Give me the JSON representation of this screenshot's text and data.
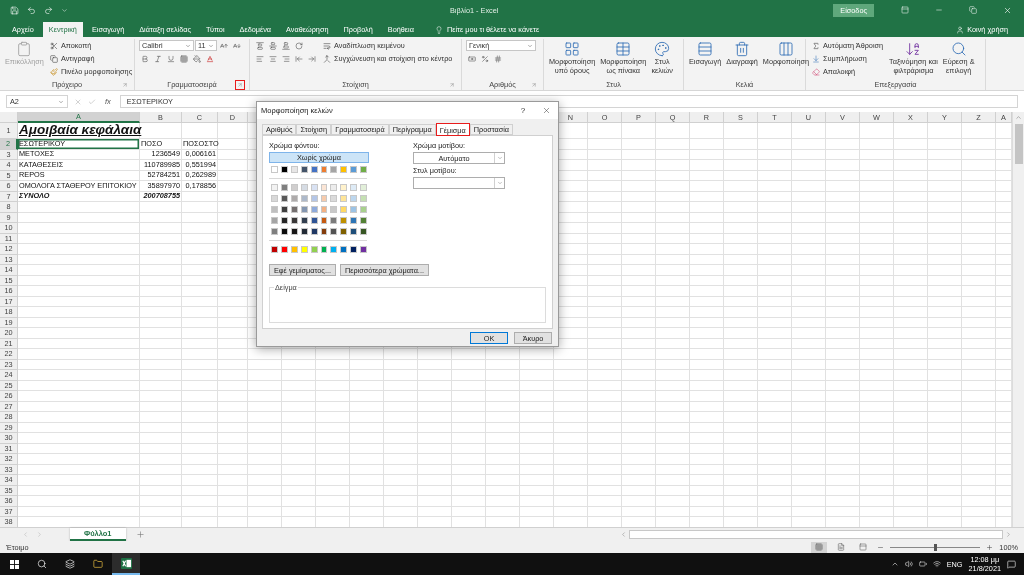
{
  "title_bar": {
    "title": "Βιβλίο1 - Excel",
    "sign_in": "Είσοδος"
  },
  "menu_tabs": [
    {
      "label": "Αρχείο",
      "selected": false
    },
    {
      "label": "Κεντρική",
      "selected": true
    },
    {
      "label": "Εισαγωγή",
      "selected": false
    },
    {
      "label": "Διάταξη σελίδας",
      "selected": false
    },
    {
      "label": "Τύποι",
      "selected": false
    },
    {
      "label": "Δεδομένα",
      "selected": false
    },
    {
      "label": "Αναθεώρηση",
      "selected": false
    },
    {
      "label": "Προβολή",
      "selected": false
    },
    {
      "label": "Βοήθεια",
      "selected": false
    }
  ],
  "tell_me": "Πείτε μου τι θέλετε να κάνετε",
  "share": "Κοινή χρήση",
  "ribbon": {
    "clipboard": {
      "label": "Πρόχειρο",
      "launcher_highlighted": false,
      "paste": {
        "label": "Επικόλληση",
        "disabled": true
      },
      "cut": "Αποκοπή",
      "copy": "Αντιγραφή",
      "format_painter": "Πινέλο μορφοποίησης"
    },
    "font": {
      "label": "Γραμματοσειρά",
      "launcher_highlighted": true,
      "font_name": "Calibri",
      "font_size": "11"
    },
    "alignment": {
      "label": "Στοίχιση",
      "launcher_highlighted": false,
      "wrap_text": "Αναδίπλωση κειμένου",
      "merge_center": "Συγχώνευση και στοίχιση στο κέντρο"
    },
    "number": {
      "label": "Αριθμός",
      "launcher_highlighted": false,
      "format": "Γενική"
    },
    "styles": {
      "label": "Στυλ",
      "buttons": [
        [
          "Μορφοποίηση",
          "υπό όρους"
        ],
        [
          "Μορφοποίηση",
          "ως πίνακα"
        ],
        [
          "Στυλ",
          "κελιών"
        ]
      ]
    },
    "cells": {
      "label": "Κελιά",
      "buttons": [
        "Εισαγωγή",
        "Διαγραφή",
        "Μορφοποίηση"
      ]
    },
    "editing": {
      "label": "Επεξεργασία",
      "autosum": "Αυτόματη Άθροιση",
      "fill": "Συμπλήρωση",
      "clear": "Απαλοιφή",
      "sort": [
        "Ταξινόμηση και",
        "φιλτράρισμα"
      ],
      "find": [
        "Εύρεση &",
        "επιλογή"
      ]
    }
  },
  "formula_bar": {
    "name_box": "A2",
    "fx": "fx",
    "value": "ΕΣΩΤΕΡΙΚΟΥ"
  },
  "sheet": {
    "columns_left": [
      "A",
      "B",
      "C",
      "D"
    ],
    "columns_right": [
      "N",
      "O",
      "P",
      "Q",
      "R",
      "S",
      "T",
      "U",
      "V",
      "W",
      "X",
      "Y",
      "Z",
      "A"
    ],
    "rows": [
      {
        "number": "1",
        "kind": "title",
        "cells": [
          {
            "text": "Αμοιβαία κεφάλαια",
            "selected": false
          }
        ]
      },
      {
        "number": "2",
        "kind": "header",
        "cells": [
          {
            "text": "ΕΣΩΤΕΡΙΚΟΥ",
            "selected": true
          },
          {
            "text": "ΠΟΣΟ",
            "selected": false
          },
          {
            "text": "ΠΟΣΟΣΤΟ",
            "selected": false
          }
        ]
      },
      {
        "number": "3",
        "kind": "data",
        "cells": [
          {
            "text": "ΜΕΤΟΧΕΣ",
            "selected": false
          },
          {
            "text": "1236549",
            "selected": false
          },
          {
            "text": "0,006161",
            "selected": false
          }
        ]
      },
      {
        "number": "4",
        "kind": "data",
        "cells": [
          {
            "text": "ΚΑΤΑΘΕΣΕΙΣ",
            "selected": false
          },
          {
            "text": "110789985",
            "selected": false
          },
          {
            "text": "0,551994",
            "selected": false
          }
        ]
      },
      {
        "number": "5",
        "kind": "data",
        "cells": [
          {
            "text": "REPOS",
            "selected": false
          },
          {
            "text": "52784251",
            "selected": false
          },
          {
            "text": "0,262989",
            "selected": false
          }
        ]
      },
      {
        "number": "6",
        "kind": "data",
        "cells": [
          {
            "text": "ΟΜΟΛΟΓΑ ΣΤΑΘΕΡΟΥ ΕΠΙΤΟΚΙΟΥ",
            "selected": false
          },
          {
            "text": "35897970",
            "selected": false
          },
          {
            "text": "0,178856",
            "selected": false
          }
        ]
      },
      {
        "number": "7",
        "kind": "total",
        "cells": [
          {
            "text": "ΣΥΝΟΛΟ",
            "selected": false
          },
          {
            "text": "200708755",
            "selected": false
          }
        ]
      },
      {
        "number": "8"
      },
      {
        "number": "9"
      },
      {
        "number": "10"
      },
      {
        "number": "11"
      },
      {
        "number": "12"
      },
      {
        "number": "13"
      },
      {
        "number": "14"
      },
      {
        "number": "15"
      },
      {
        "number": "16"
      },
      {
        "number": "17"
      },
      {
        "number": "18"
      },
      {
        "number": "19"
      },
      {
        "number": "20"
      },
      {
        "number": "21"
      },
      {
        "number": "22"
      },
      {
        "number": "23"
      },
      {
        "number": "24"
      },
      {
        "number": "25"
      },
      {
        "number": "26"
      },
      {
        "number": "27"
      },
      {
        "number": "28"
      },
      {
        "number": "29"
      },
      {
        "number": "30"
      },
      {
        "number": "31"
      },
      {
        "number": "32"
      },
      {
        "number": "33"
      },
      {
        "number": "34"
      },
      {
        "number": "35"
      },
      {
        "number": "36"
      },
      {
        "number": "37"
      },
      {
        "number": "38"
      }
    ]
  },
  "dialog": {
    "title": "Μορφοποίηση κελιών",
    "help": "?",
    "tabs": [
      {
        "label": "Αριθμός",
        "selected": false,
        "highlighted": false
      },
      {
        "label": "Στοίχιση",
        "selected": false,
        "highlighted": false
      },
      {
        "label": "Γραμματοσειρά",
        "selected": false,
        "highlighted": false
      },
      {
        "label": "Περίγραμμα",
        "selected": false,
        "highlighted": false
      },
      {
        "label": "Γέμισμα",
        "selected": true,
        "highlighted": true
      },
      {
        "label": "Προστασία",
        "selected": false,
        "highlighted": false
      }
    ],
    "background_label": "Χρώμα φόντου:",
    "no_color": "Χωρίς χρώμα",
    "theme_colors": [
      {
        "color": "#ffffff"
      },
      {
        "color": "#000000"
      },
      {
        "color": "#e7e6e6"
      },
      {
        "color": "#44546a"
      },
      {
        "color": "#4472c4"
      },
      {
        "color": "#ed7d31"
      },
      {
        "color": "#a5a5a5"
      },
      {
        "color": "#ffc000"
      },
      {
        "color": "#5b9bd5"
      },
      {
        "color": "#70ad47"
      }
    ],
    "tint_rows": [
      [
        {
          "color": "#f2f2f2"
        },
        {
          "color": "#7f7f7f"
        },
        {
          "color": "#d0cece"
        },
        {
          "color": "#d6dce4"
        },
        {
          "color": "#d9e2f3"
        },
        {
          "color": "#fbe5d5"
        },
        {
          "color": "#ededed"
        },
        {
          "color": "#fff2cc"
        },
        {
          "color": "#deebf6"
        },
        {
          "color": "#e2efd9"
        }
      ],
      [
        {
          "color": "#d8d8d8"
        },
        {
          "color": "#595959"
        },
        {
          "color": "#aeabab"
        },
        {
          "color": "#adb9ca"
        },
        {
          "color": "#b4c6e7"
        },
        {
          "color": "#f7cbac"
        },
        {
          "color": "#dbdbdb"
        },
        {
          "color": "#fee599"
        },
        {
          "color": "#bdd7ee"
        },
        {
          "color": "#c5e0b3"
        }
      ],
      [
        {
          "color": "#bfbfbf"
        },
        {
          "color": "#3f3f3f"
        },
        {
          "color": "#757070"
        },
        {
          "color": "#8496b0"
        },
        {
          "color": "#8eaadb"
        },
        {
          "color": "#f4b183"
        },
        {
          "color": "#c9c9c9"
        },
        {
          "color": "#ffd965"
        },
        {
          "color": "#9cc3e5"
        },
        {
          "color": "#a8d08d"
        }
      ],
      [
        {
          "color": "#a5a5a5"
        },
        {
          "color": "#262626"
        },
        {
          "color": "#3a3838"
        },
        {
          "color": "#323f4f"
        },
        {
          "color": "#2f5496"
        },
        {
          "color": "#c55a11"
        },
        {
          "color": "#7b7b7b"
        },
        {
          "color": "#bf9000"
        },
        {
          "color": "#2e75b5"
        },
        {
          "color": "#538135"
        }
      ],
      [
        {
          "color": "#7f7f7f"
        },
        {
          "color": "#0c0c0c"
        },
        {
          "color": "#171616"
        },
        {
          "color": "#222a35"
        },
        {
          "color": "#1f3864"
        },
        {
          "color": "#833c0b"
        },
        {
          "color": "#525252"
        },
        {
          "color": "#7f6000"
        },
        {
          "color": "#1e4e79"
        },
        {
          "color": "#375623"
        }
      ]
    ],
    "standard_colors": [
      {
        "color": "#c00000"
      },
      {
        "color": "#ff0000"
      },
      {
        "color": "#ffc000"
      },
      {
        "color": "#ffff00"
      },
      {
        "color": "#92d050"
      },
      {
        "color": "#00b050"
      },
      {
        "color": "#00b0f0"
      },
      {
        "color": "#0070c0"
      },
      {
        "color": "#002060"
      },
      {
        "color": "#7030a0"
      }
    ],
    "fill_effects": "Εφέ γεμίσματος...",
    "more_colors": "Περισσότερα χρώματα...",
    "pattern_color_label": "Χρώμα μοτίβου:",
    "pattern_color": "Αυτόματο",
    "pattern_style_label": "Στυλ μοτίβου:",
    "sample_label": "Δείγμα",
    "ok": "OK",
    "cancel": "Άκυρο"
  },
  "sheet_tabs": [
    {
      "label": "Φύλλο1",
      "selected": true
    }
  ],
  "status": "Έτοιμο",
  "zoom": {
    "level": 0.5,
    "reading": "100%"
  },
  "taskbar": {
    "language": "ENG",
    "time": "12:08 μμ",
    "date": "21/8/2021"
  }
}
